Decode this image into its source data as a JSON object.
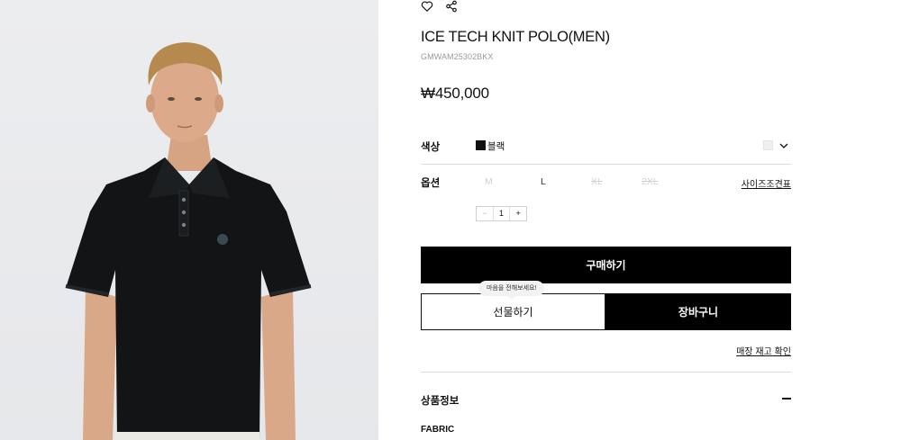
{
  "product": {
    "title": "ICE TECH KNIT POLO(MEN)",
    "code": "GMWAM25302BKX",
    "price": "₩450,000",
    "image_alt": "Black knit polo worn by a model"
  },
  "actions": {
    "wishlist_icon": "heart-icon",
    "share_icon": "share-icon"
  },
  "color": {
    "label": "색상",
    "selected_name": "블랙",
    "selected_hex": "#111111",
    "thumb_hex": "#efefef"
  },
  "options": {
    "label": "옵션",
    "sizes": [
      {
        "label": "M",
        "state": "disabled"
      },
      {
        "label": "L",
        "state": "available"
      },
      {
        "label": "XL",
        "state": "soldout"
      },
      {
        "label": "2XL",
        "state": "soldout"
      }
    ],
    "size_chart_label": "사이즈조견표"
  },
  "quantity": {
    "minus": "−",
    "value": "1",
    "plus": "+"
  },
  "buttons": {
    "buy": "구매하기",
    "gift": "선물하기",
    "cart": "장바구니",
    "gift_tooltip": "마음을 전해보세요!"
  },
  "stock_link": "매장 재고 확인",
  "info": {
    "section_title": "상품정보",
    "fabric_label": "FABRIC"
  },
  "colors": {
    "accent": "#000000",
    "divider": "#dcdcdc",
    "disabled_text": "#d2d2d2"
  }
}
